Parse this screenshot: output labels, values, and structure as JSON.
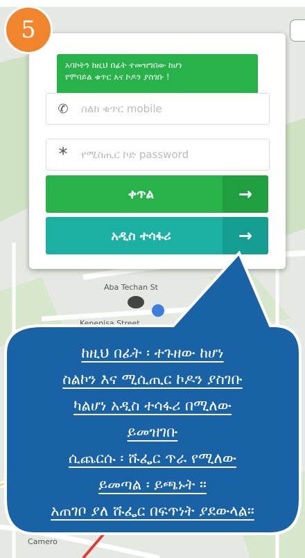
{
  "step_number": "5",
  "tooltip": {
    "line1": "አባኮትን ከዚህ በፊት ተመዝግበው ከሆነ",
    "line2": "የሞባይል ቁጥር እና ኮዶን ያስገቡ !"
  },
  "phone_field": {
    "placeholder": "ስልክ ቁጥር mobile",
    "value": ""
  },
  "password_field": {
    "placeholder": "የሚስጢር ኮድ password",
    "value": ""
  },
  "login_button": {
    "label": "ቀጥል",
    "arrow": "→"
  },
  "register_button": {
    "label": "አዲስ ተሳፋሪ",
    "arrow": "→"
  },
  "map_labels": {
    "street1": "Aba Techan St",
    "street2": "Kenenisa Street",
    "street3": "Camero"
  },
  "instructions": [
    "ከዚህ በፊት ፡ ተጉዘው  ከሆነ",
    "ስልኮን እና ሚሲጢር ኮዶን ያስገቡ",
    "ካልሆነ አዲስ ተሳፋሪ በሚለው",
    "ይመዝገቡ",
    "ሲጨርሱ ፡ ሹፌር ጥራ የሚለው",
    "ይመጣል ፡ ይጫኑት ።",
    "አጠገቦ ያለ ሹፌር በፍጥነት ያደውላል።"
  ],
  "colors": {
    "green": "#27b24a",
    "teal": "#1cb0a3",
    "bubble_blue": "#1a62a6",
    "badge_orange": "#f0852e"
  }
}
